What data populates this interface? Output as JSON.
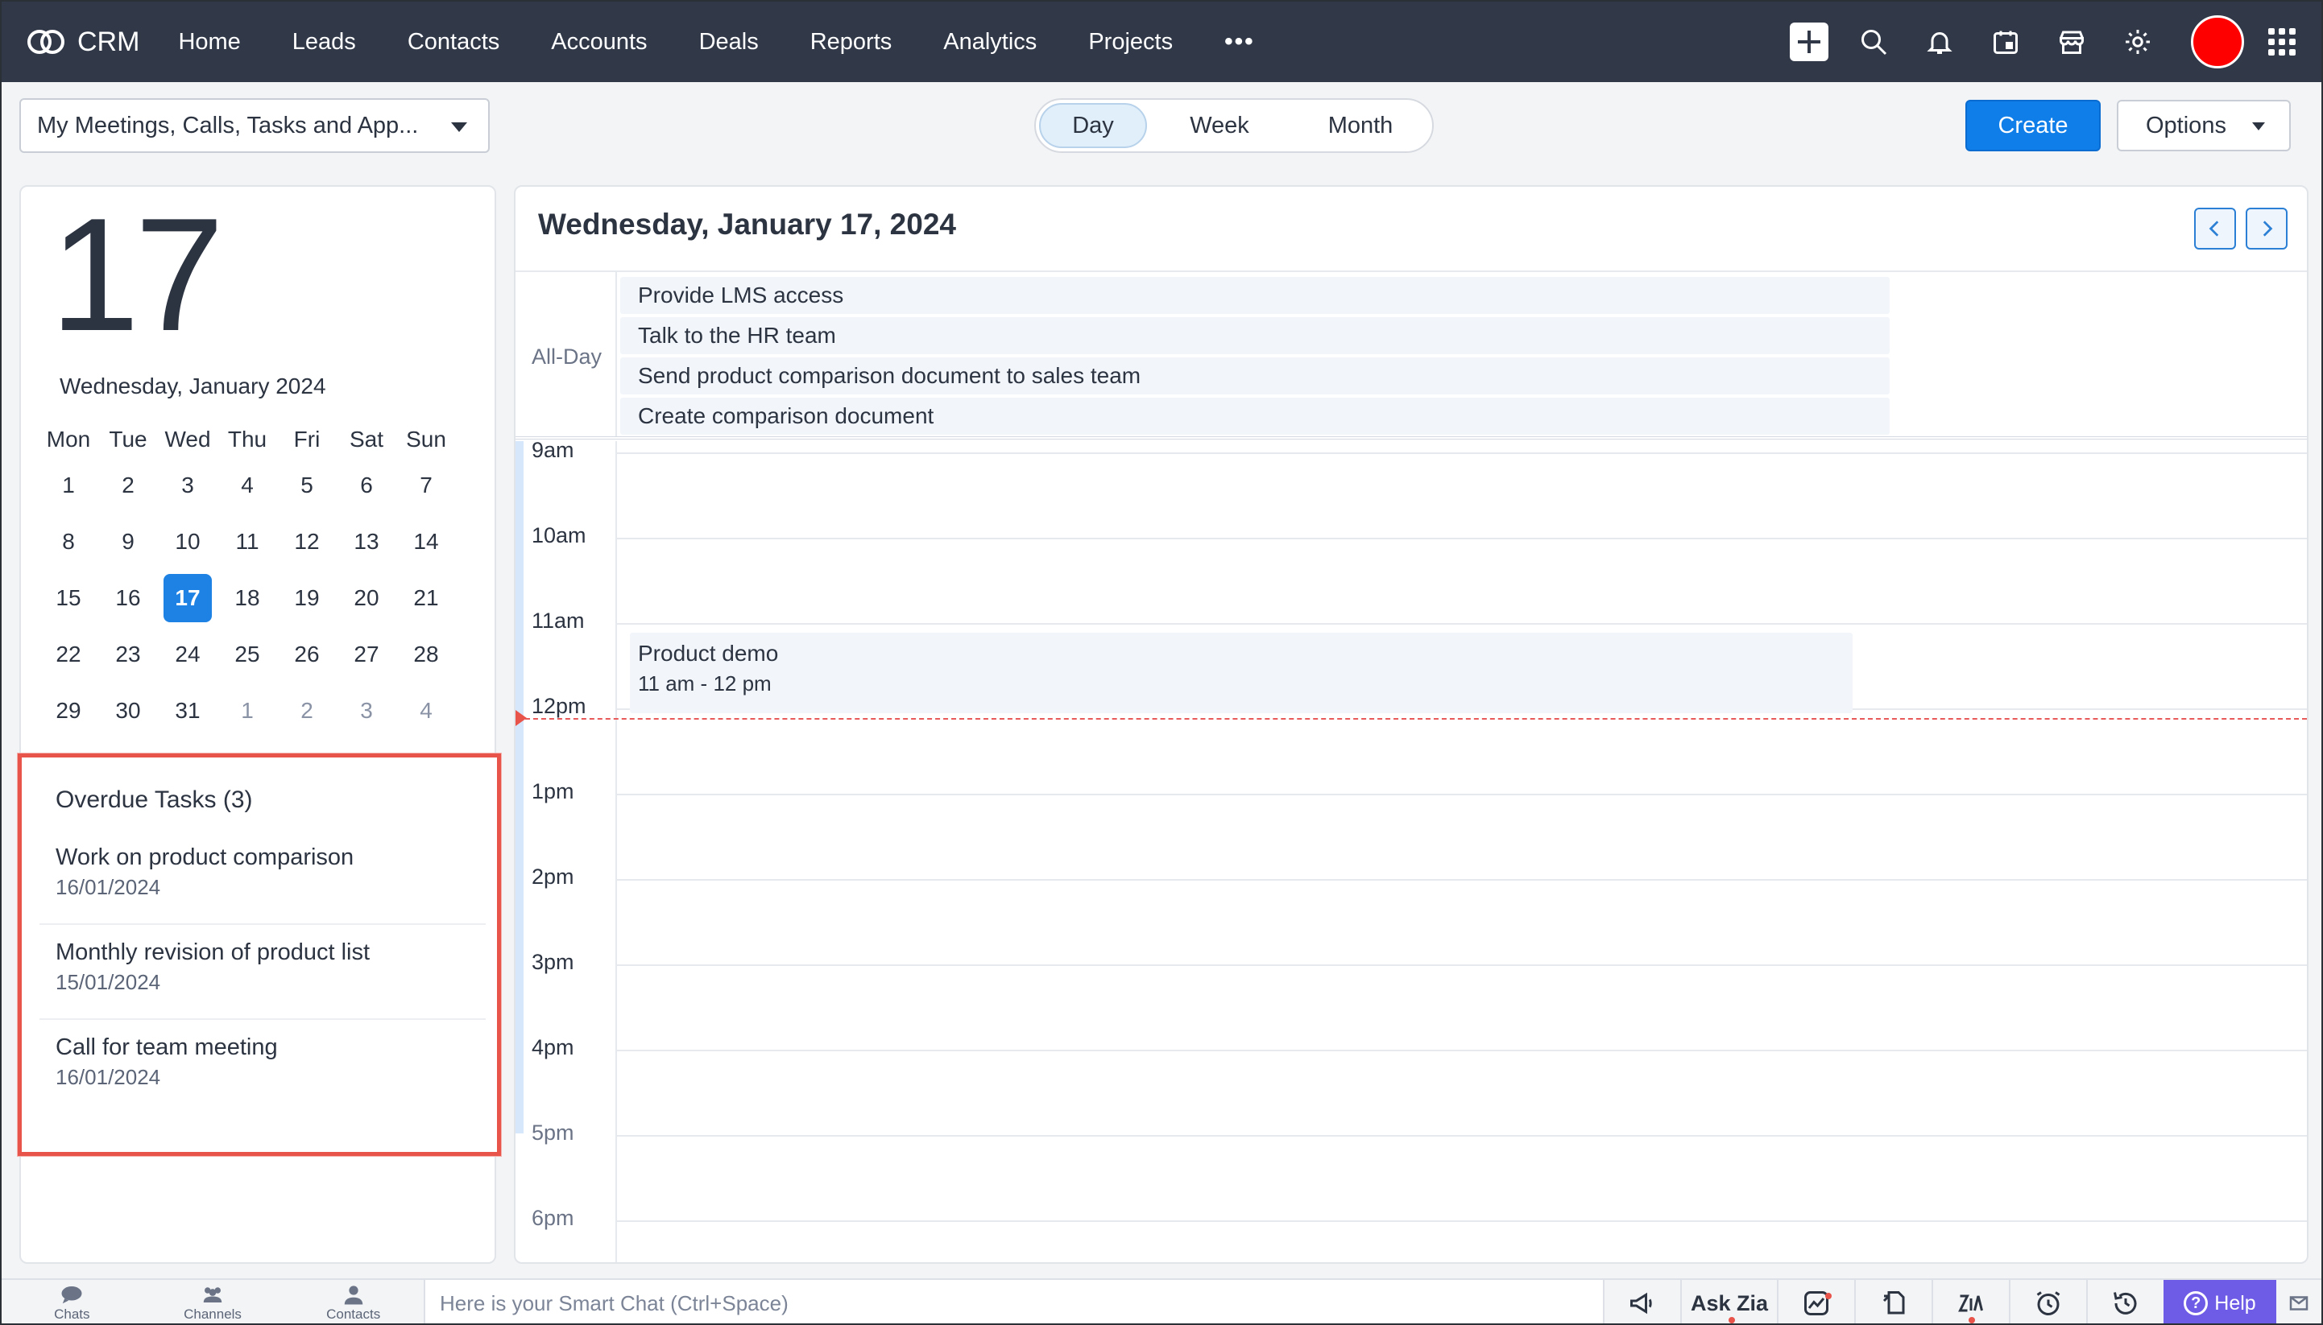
{
  "app": {
    "name": "CRM",
    "colors": {
      "nav_bg": "#313949",
      "accent": "#0f7ee8",
      "today": "#1d82e3",
      "highlight": "#e8534a",
      "help": "#6f5ce6"
    }
  },
  "nav": {
    "items": [
      "Home",
      "Leads",
      "Contacts",
      "Accounts",
      "Deals",
      "Reports",
      "Analytics",
      "Projects"
    ],
    "more": "•••",
    "icons": [
      "plus-icon",
      "search-icon",
      "bell-icon",
      "calendar-icon",
      "store-icon",
      "gear-icon",
      "avatar",
      "apps-grid-icon"
    ]
  },
  "toolbar": {
    "filter_value": "My Meetings, Calls, Tasks and App...",
    "views": {
      "day": "Day",
      "week": "Week",
      "month": "Month"
    },
    "active_view": "Day",
    "create_label": "Create",
    "options_label": "Options"
  },
  "mini_calendar": {
    "day_number": "17",
    "month_label": "Wednesday, January 2024",
    "weekdays": [
      "Mon",
      "Tue",
      "Wed",
      "Thu",
      "Fri",
      "Sat",
      "Sun"
    ],
    "weeks": [
      [
        "1",
        "2",
        "3",
        "4",
        "5",
        "6",
        "7"
      ],
      [
        "8",
        "9",
        "10",
        "11",
        "12",
        "13",
        "14"
      ],
      [
        "15",
        "16",
        "17",
        "18",
        "19",
        "20",
        "21"
      ],
      [
        "22",
        "23",
        "24",
        "25",
        "26",
        "27",
        "28"
      ],
      [
        "29",
        "30",
        "31",
        "1",
        "2",
        "3",
        "4"
      ]
    ],
    "today": "17"
  },
  "overdue": {
    "title": "Overdue Tasks (3)",
    "tasks": [
      {
        "title": "Work on product comparison",
        "date": "16/01/2024"
      },
      {
        "title": "Monthly revision of product list",
        "date": "15/01/2024"
      },
      {
        "title": "Call for team meeting",
        "date": "16/01/2024"
      }
    ]
  },
  "day_view": {
    "date_title": "Wednesday, January 17, 2024",
    "allday_label": "All-Day",
    "allday_events": [
      "Provide LMS access",
      "Talk to the HR team",
      "Send product comparison document to sales team",
      "Create comparison document"
    ],
    "hours": [
      "9am",
      "10am",
      "11am",
      "12pm",
      "1pm",
      "2pm",
      "3pm",
      "4pm",
      "5pm",
      "6pm"
    ],
    "event": {
      "title": "Product demo",
      "time": "11 am - 12 pm"
    }
  },
  "bottom_bar": {
    "tabs": [
      "Chats",
      "Channels",
      "Contacts"
    ],
    "smartchat_placeholder": "Here is your Smart Chat (Ctrl+Space)",
    "ask_zia": "Ask Zia",
    "help": "Help"
  }
}
